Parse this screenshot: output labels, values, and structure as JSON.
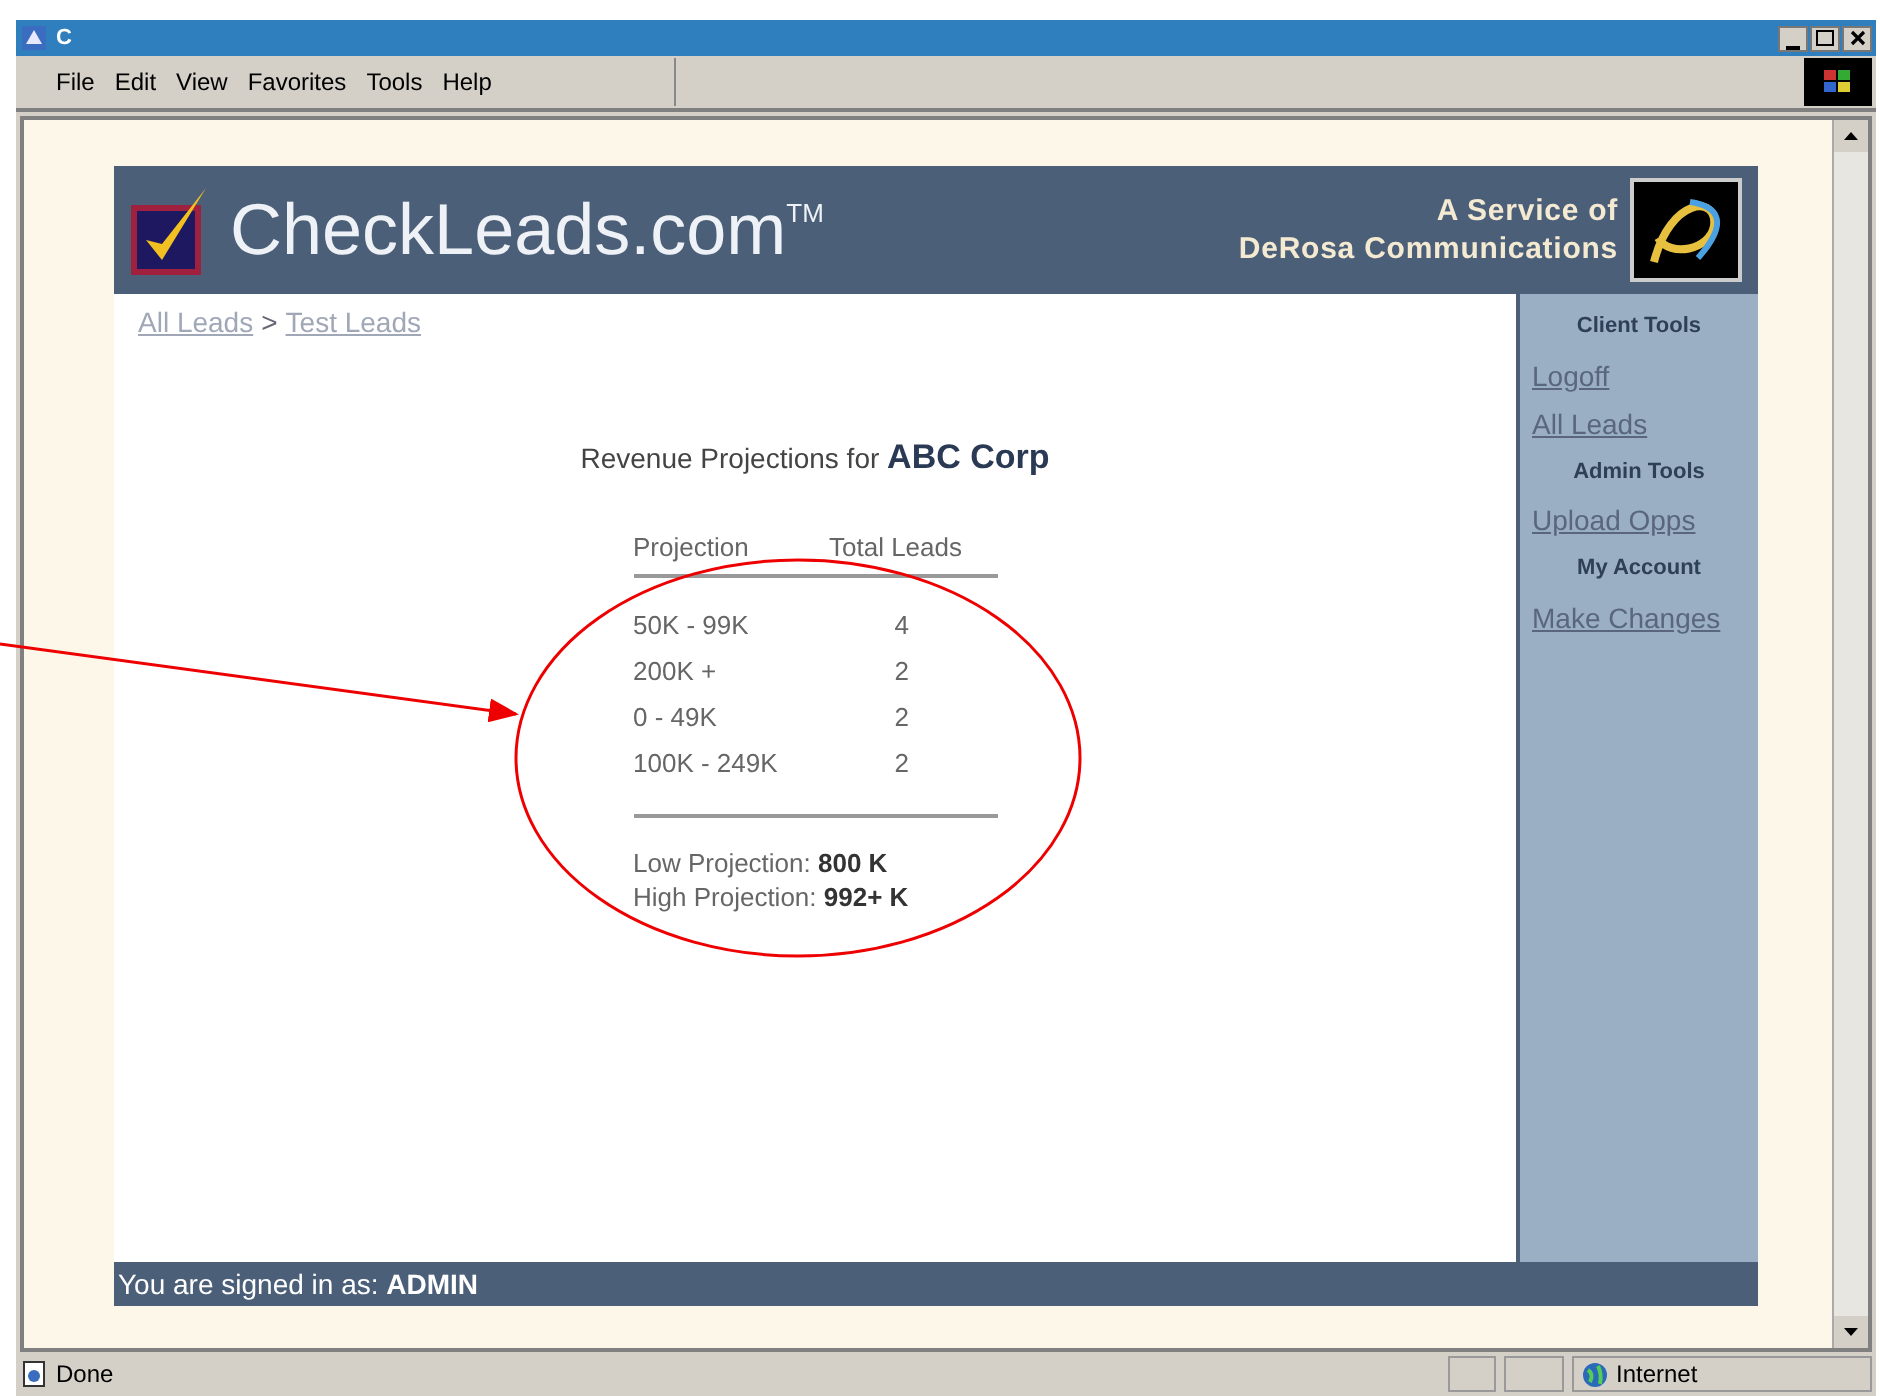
{
  "window": {
    "title": "C"
  },
  "menu": [
    "File",
    "Edit",
    "View",
    "Favorites",
    "Tools",
    "Help"
  ],
  "header": {
    "logo": "CheckLeads.com",
    "trademark": "TM",
    "service_line_1": "A Service of",
    "service_line_2": "DeRosa Communications"
  },
  "breadcrumb": [
    {
      "label": "All Leads"
    },
    {
      "label": "Test Leads"
    }
  ],
  "breadcrumb_separator": ">",
  "report": {
    "title": "Revenue Projections for **ABC Corp**",
    "columns": [
      "Projection",
      "Total Leads"
    ],
    "rows": [
      [
        "50K - 99K",
        "4"
      ],
      [
        "200K +",
        "2"
      ],
      [
        "0 - 49K",
        "2"
      ],
      [
        "100K - 249K",
        "2"
      ]
    ],
    "summary": [
      "Low Projection: **800 K**",
      "High Projection: **992+ K**"
    ]
  },
  "sidebar": {
    "items": [
      {
        "kind": "heading",
        "label": "Client Tools"
      },
      {
        "kind": "link",
        "label": "Logoff"
      },
      {
        "kind": "link",
        "label": "All Leads"
      },
      {
        "kind": "heading",
        "label": "Admin Tools"
      },
      {
        "kind": "link",
        "label": "Upload Opps"
      },
      {
        "kind": "heading",
        "label": "My Account"
      },
      {
        "kind": "link",
        "label": "Make Changes"
      }
    ]
  },
  "footer": "You are signed in as: **ADMIN**",
  "status_bar": {
    "text": "Done",
    "zone": "Internet"
  }
}
